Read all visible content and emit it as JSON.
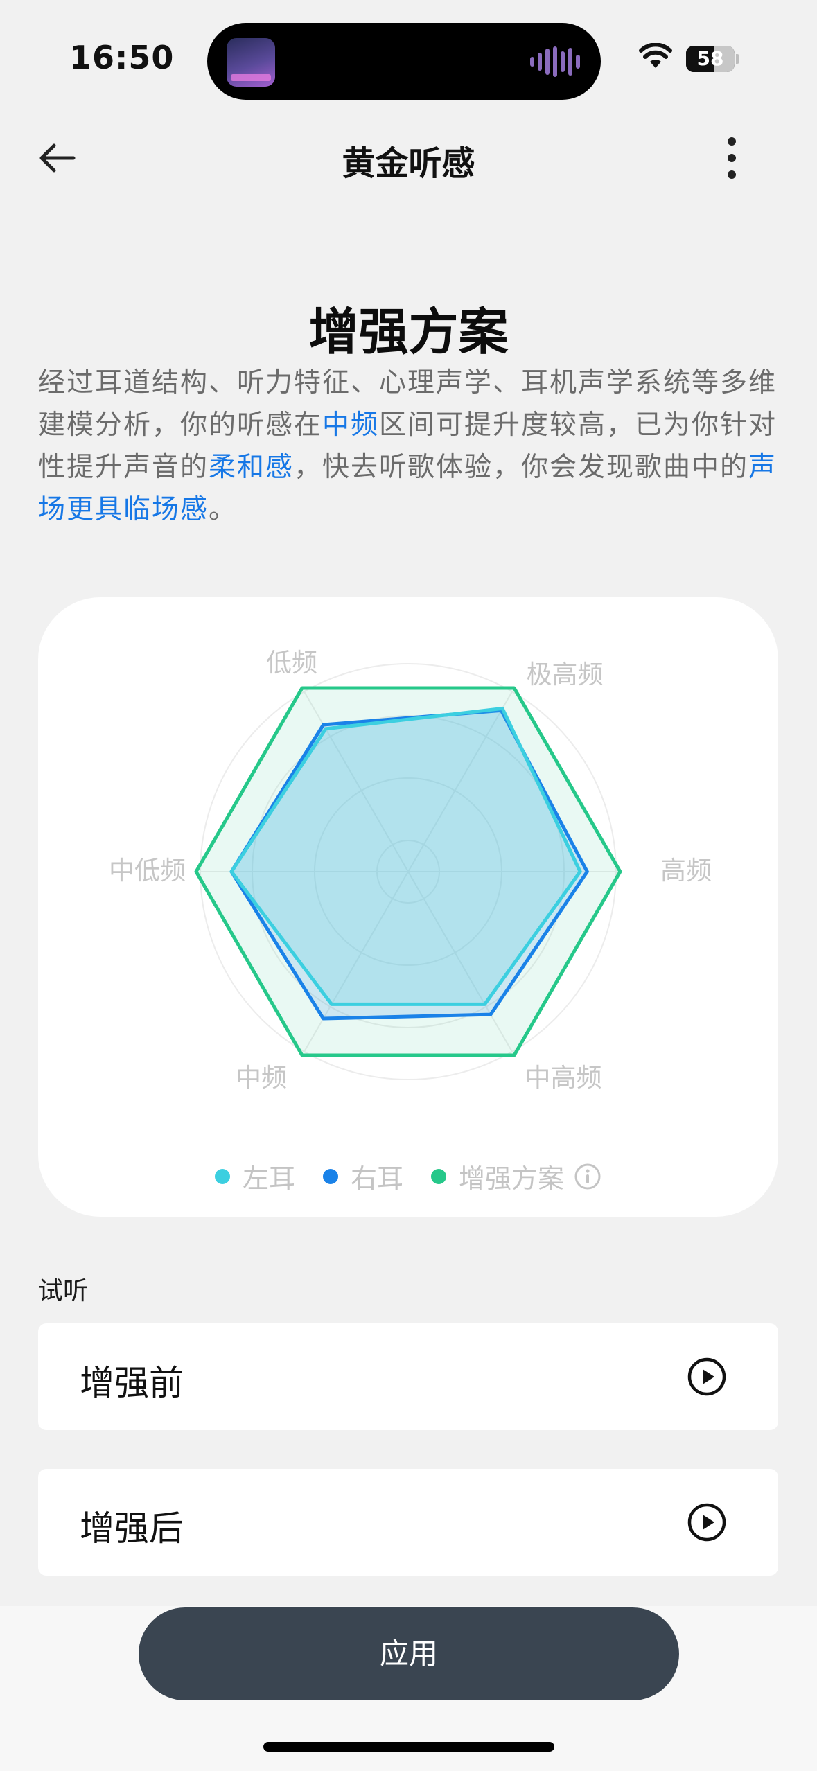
{
  "status_bar": {
    "time": "16:50",
    "battery": "58"
  },
  "nav": {
    "title": "黄金听感"
  },
  "headline": "增强方案",
  "description": [
    {
      "text": "经过耳道结构、听力特征、心理声学、耳机声学系统等多维建模分析，你的听感在",
      "highlight": false
    },
    {
      "text": "中频",
      "highlight": true
    },
    {
      "text": "区间可提升度较高，已为你针对性提升声音的",
      "highlight": false
    },
    {
      "text": "柔和感",
      "highlight": true
    },
    {
      "text": "，快去听歌体验，你会发现歌曲中的",
      "highlight": false
    },
    {
      "text": "声场更具临场感",
      "highlight": true
    },
    {
      "text": "。",
      "highlight": false
    }
  ],
  "chart_data": {
    "type": "radar",
    "axes": [
      "低频",
      "极高频",
      "高频",
      "中高频",
      "中频",
      "中低频"
    ],
    "range": [
      0,
      100
    ],
    "series": [
      {
        "name": "左耳",
        "color": "#3ccfe0",
        "values": [
          70,
          80,
          73,
          65,
          65,
          75
        ]
      },
      {
        "name": "右耳",
        "color": "#1a82e8",
        "values": [
          72,
          79,
          76,
          70,
          72,
          75
        ]
      },
      {
        "name": "增强方案",
        "color": "#26c88a",
        "values": [
          90,
          90,
          90,
          90,
          90,
          90
        ]
      }
    ]
  },
  "audition": {
    "label": "试听",
    "items": [
      {
        "label": "增强前",
        "icon": "play-circle-icon"
      },
      {
        "label": "增强后",
        "icon": "play-circle-icon"
      }
    ]
  },
  "apply_label": "应用"
}
